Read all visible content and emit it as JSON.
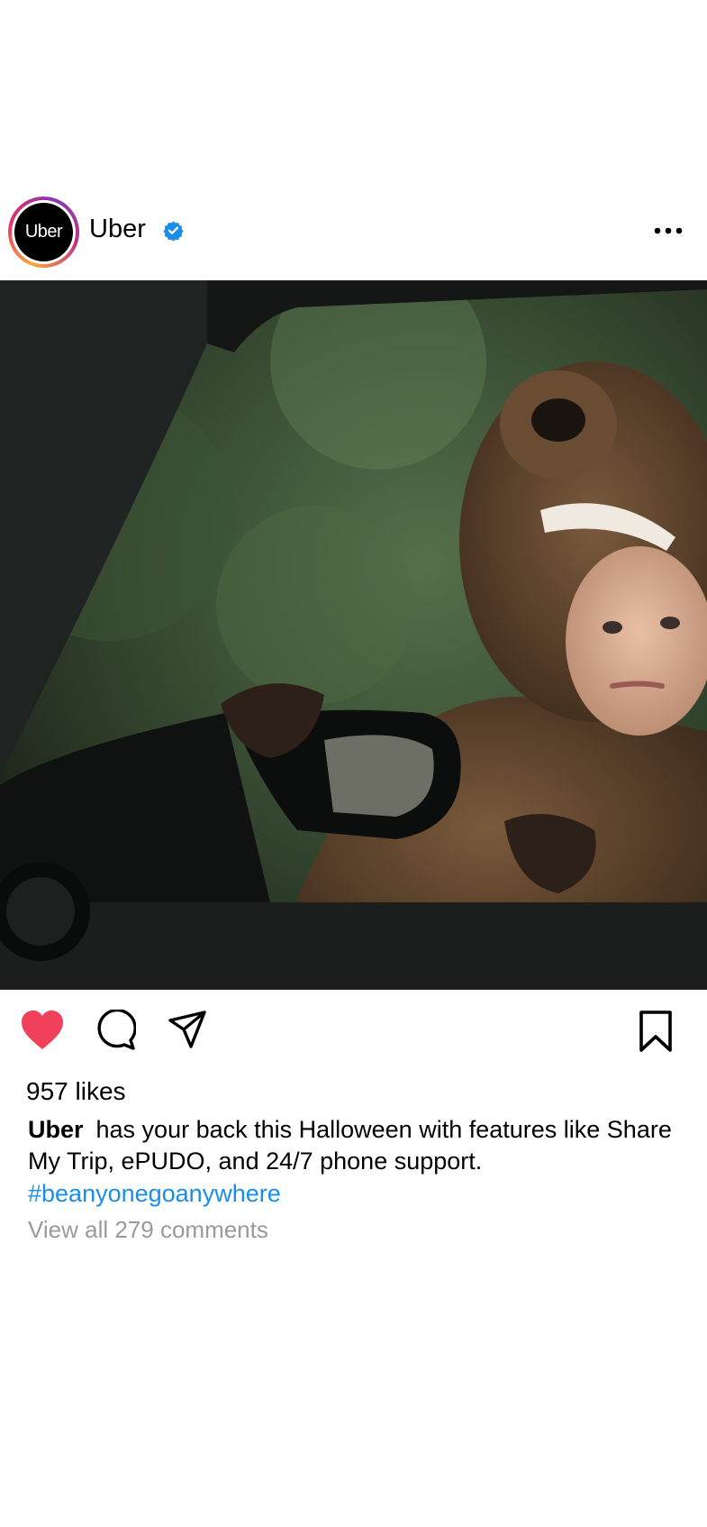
{
  "account": {
    "avatar_text": "Uber",
    "username": "Uber",
    "verified_icon": "verified-badge-icon",
    "more_icon": "more-options-icon"
  },
  "photo": {
    "icon": "post-photo"
  },
  "actions": {
    "like_icon": "heart-filled-icon",
    "comment_icon": "comment-icon",
    "share_icon": "share-icon",
    "save_icon": "bookmark-icon",
    "like_color": "#f0405a"
  },
  "likes_text": "957 likes",
  "caption": {
    "author": "Uber",
    "text": "has your back this Halloween with features like Share My Trip, ePUDO, and 24/7 phone support.",
    "hashtag": "#beanyonegoanywhere",
    "hashtag_color": "#1a8ee8"
  },
  "view_all_comments": "View all 279 comments"
}
